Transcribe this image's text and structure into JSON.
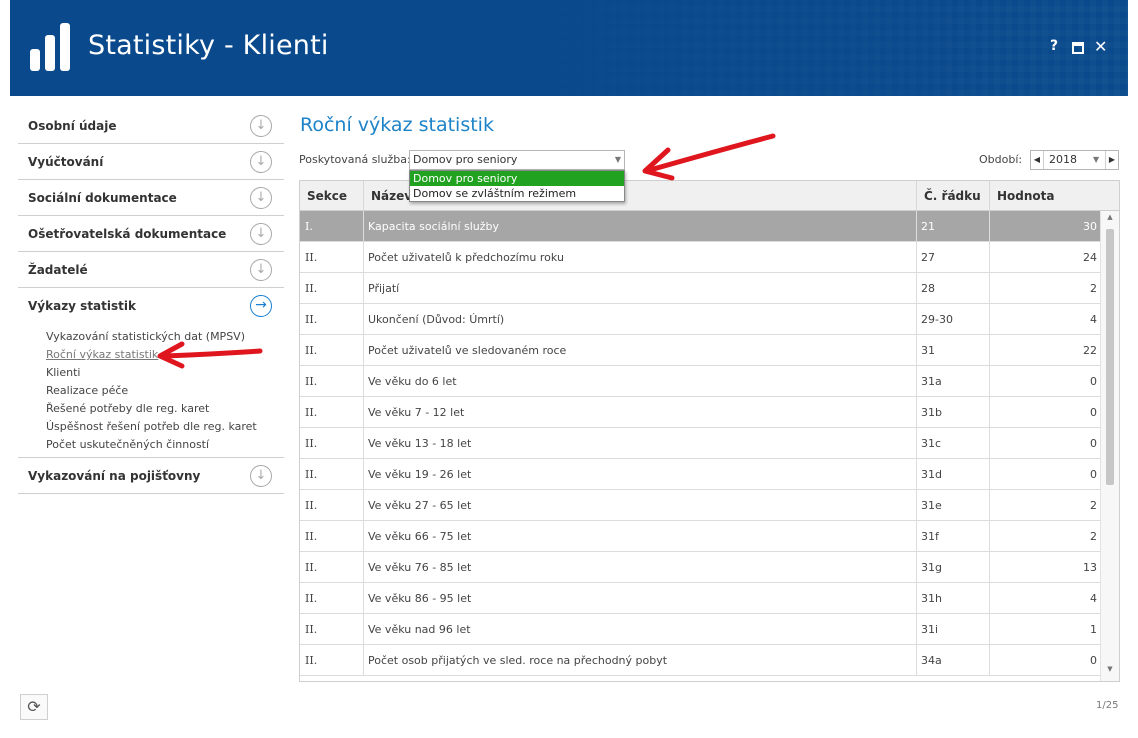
{
  "app": {
    "title": "Statistiky - Klienti",
    "help_label": "?",
    "close_label": "✕"
  },
  "sidebar": {
    "items": [
      {
        "label": "Osobní údaje"
      },
      {
        "label": "Vyúčtování"
      },
      {
        "label": "Sociální dokumentace"
      },
      {
        "label": "Ošetřovatelská dokumentace"
      },
      {
        "label": "Žadatelé"
      },
      {
        "label": "Výkazy statistik"
      },
      {
        "label": "Vykazování na pojišťovny"
      }
    ],
    "subitems": [
      {
        "label": "Vykazování statistických dat (MPSV)"
      },
      {
        "label": "Roční výkaz statistik"
      },
      {
        "label": "Klienti"
      },
      {
        "label": "Realizace péče"
      },
      {
        "label": "Řešené potřeby dle reg. karet"
      },
      {
        "label": "Úspěšnost řešení potřeb dle reg. karet"
      },
      {
        "label": "Počet uskutečněných činností"
      }
    ]
  },
  "main": {
    "title": "Roční výkaz statistik",
    "service_label": "Poskytovaná služba:",
    "service_value": "Domov pro seniory",
    "service_options": [
      "Domov pro seniory",
      "Domov se zvláštním režimem"
    ],
    "period_label": "Období:",
    "period_value": "2018"
  },
  "table": {
    "columns": [
      "Sekce",
      "Název",
      "Č. řádku",
      "Hodnota"
    ],
    "rows": [
      {
        "sekce": "I.",
        "nazev": "Kapacita sociální služby",
        "radek": "21",
        "hodnota": "30"
      },
      {
        "sekce": "II.",
        "nazev": "Počet uživatelů k předchozímu roku",
        "radek": "27",
        "hodnota": "24"
      },
      {
        "sekce": "II.",
        "nazev": "Přijatí",
        "radek": "28",
        "hodnota": "2"
      },
      {
        "sekce": "II.",
        "nazev": "Ukončení (Důvod: Úmrtí)",
        "radek": "29-30",
        "hodnota": "4"
      },
      {
        "sekce": "II.",
        "nazev": "Počet uživatelů ve sledovaném roce",
        "radek": "31",
        "hodnota": "22"
      },
      {
        "sekce": "II.",
        "nazev": "Ve věku do 6 let",
        "radek": "31a",
        "hodnota": "0"
      },
      {
        "sekce": "II.",
        "nazev": "Ve věku 7 - 12 let",
        "radek": "31b",
        "hodnota": "0"
      },
      {
        "sekce": "II.",
        "nazev": "Ve věku 13 - 18 let",
        "radek": "31c",
        "hodnota": "0"
      },
      {
        "sekce": "II.",
        "nazev": "Ve věku 19 - 26 let",
        "radek": "31d",
        "hodnota": "0"
      },
      {
        "sekce": "II.",
        "nazev": "Ve věku 27 - 65 let",
        "radek": "31e",
        "hodnota": "2"
      },
      {
        "sekce": "II.",
        "nazev": "Ve věku 66 - 75 let",
        "radek": "31f",
        "hodnota": "2"
      },
      {
        "sekce": "II.",
        "nazev": "Ve věku 76 - 85 let",
        "radek": "31g",
        "hodnota": "13"
      },
      {
        "sekce": "II.",
        "nazev": "Ve věku 86 - 95 let",
        "radek": "31h",
        "hodnota": "4"
      },
      {
        "sekce": "II.",
        "nazev": "Ve věku nad 96 let",
        "radek": "31i",
        "hodnota": "1"
      },
      {
        "sekce": "II.",
        "nazev": "Počet osob přijatých ve sled. roce na přechodný pobyt",
        "radek": "34a",
        "hodnota": "0"
      }
    ]
  },
  "footer": {
    "pager": "1/25"
  },
  "colors": {
    "header_bg": "#0a4a8c",
    "accent": "#1d83c8",
    "dropdown_selected": "#21a321",
    "row_selected": "#a6a6a6",
    "annotation_arrow": "#e0161e"
  }
}
